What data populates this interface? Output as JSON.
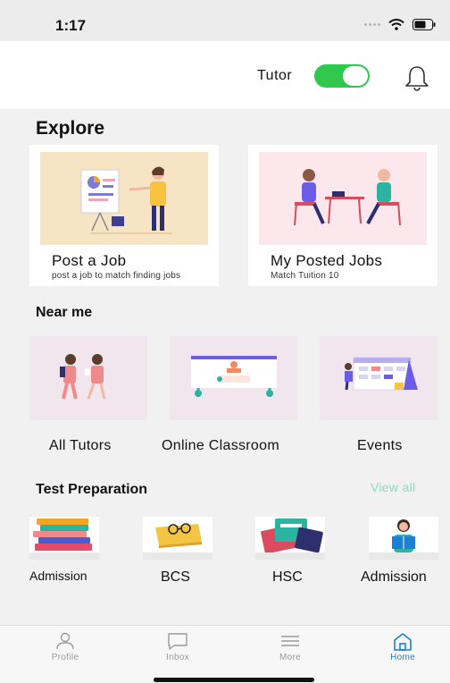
{
  "status_bar": {
    "time": "1:17"
  },
  "header": {
    "toggle_label": "Tutor",
    "toggle_on": true
  },
  "explore": {
    "title": "Explore",
    "cards": [
      {
        "title": "Post a Job",
        "subtitle": "post a job to match finding jobs"
      },
      {
        "title": "My Posted Jobs",
        "subtitle": "Match Tuition 10"
      }
    ]
  },
  "near_me": {
    "title": "Near me",
    "items": [
      {
        "label": "All Tutors"
      },
      {
        "label": "Online Classroom"
      },
      {
        "label": "Events"
      }
    ]
  },
  "test_prep": {
    "title": "Test Preparation",
    "view_all": "View all",
    "items": [
      {
        "label": "Admission"
      },
      {
        "label": "BCS"
      },
      {
        "label": "HSC"
      },
      {
        "label": "Admission"
      }
    ]
  },
  "tab_bar": {
    "tabs": [
      {
        "label": "Profile",
        "icon": "person-icon"
      },
      {
        "label": "Inbox",
        "icon": "chat-icon"
      },
      {
        "label": "More",
        "icon": "menu-icon"
      },
      {
        "label": "Home",
        "icon": "home-icon"
      }
    ],
    "active_tab": "Home"
  },
  "colors": {
    "accent": "#1d7fd3",
    "toggle": "#30c94e",
    "view_all": "#8fd9c1",
    "card_tint": "#f2e6ee"
  }
}
